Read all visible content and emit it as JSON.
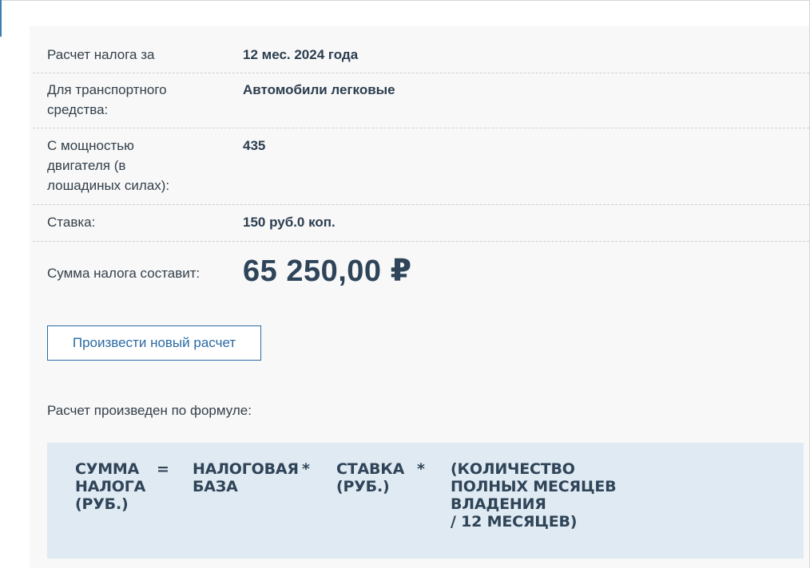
{
  "result": {
    "period_label": "Расчет налога за",
    "period_value": "12 мес. 2024 года",
    "vehicle_label": "Для транспортного средства:",
    "vehicle_value": "Автомобили легковые",
    "power_label": "С мощностью двигателя (в лошадиных силах):",
    "power_value": "435",
    "rate_label": "Ставка:",
    "rate_value": "150 руб.0 коп.",
    "total_label": "Сумма налога составит:",
    "total_value": "65 250,00 ₽"
  },
  "actions": {
    "new_calc_label": "Произвести новый расчет"
  },
  "formula": {
    "caption": "Расчет произведен по формуле:",
    "term1": "СУММА\nНАЛОГА\n(РУБ.)",
    "equals": "=",
    "term2": "НАЛОГОВАЯ\nБАЗА",
    "op1": "*",
    "term3": "СТАВКА\n(РУБ.)",
    "op2": "*",
    "term4": "(КОЛИЧЕСТВО\nПОЛНЫХ МЕСЯЦЕВ\nВЛАДЕНИЯ\n/ 12 МЕСЯЦЕВ)"
  },
  "colors": {
    "accent": "#2a6aa3",
    "panel_bg": "#f8f8f8",
    "formula_bg": "#e0eaf2",
    "text": "#2b3a48"
  }
}
